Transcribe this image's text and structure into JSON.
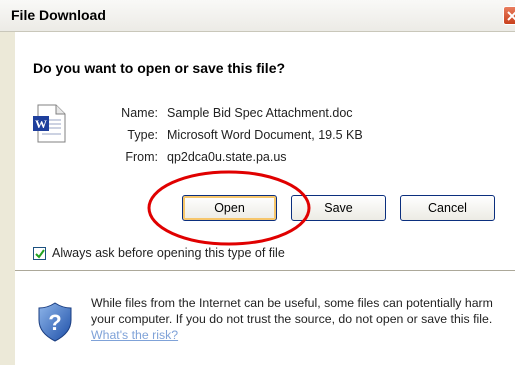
{
  "window": {
    "title": "File Download"
  },
  "main": {
    "question": "Do you want to open or save this file?",
    "file_icon": "word-document-icon",
    "name_label": "Name:",
    "name_value": "Sample Bid Spec Attachment.doc",
    "type_label": "Type:",
    "type_value": "Microsoft Word Document, 19.5 KB",
    "from_label": "From:",
    "from_value": "qp2dca0u.state.pa.us"
  },
  "buttons": {
    "open": "Open",
    "save": "Save",
    "cancel": "Cancel"
  },
  "options": {
    "always_ask_label": "Always ask before opening this type of file",
    "always_ask_checked": true
  },
  "warning": {
    "icon": "shield-question-icon",
    "text": "While files from the Internet can be useful, some files can potentially harm your computer. If you do not trust the source, do not open or save this file.",
    "link": "What's the risk?"
  },
  "colors": {
    "dialog_bg": "#ece9d8",
    "button_border": "#0b2f7e",
    "default_button_highlight": "#f6c66b",
    "annotation_circle": "#e00000",
    "link": "#7fa2d8"
  }
}
